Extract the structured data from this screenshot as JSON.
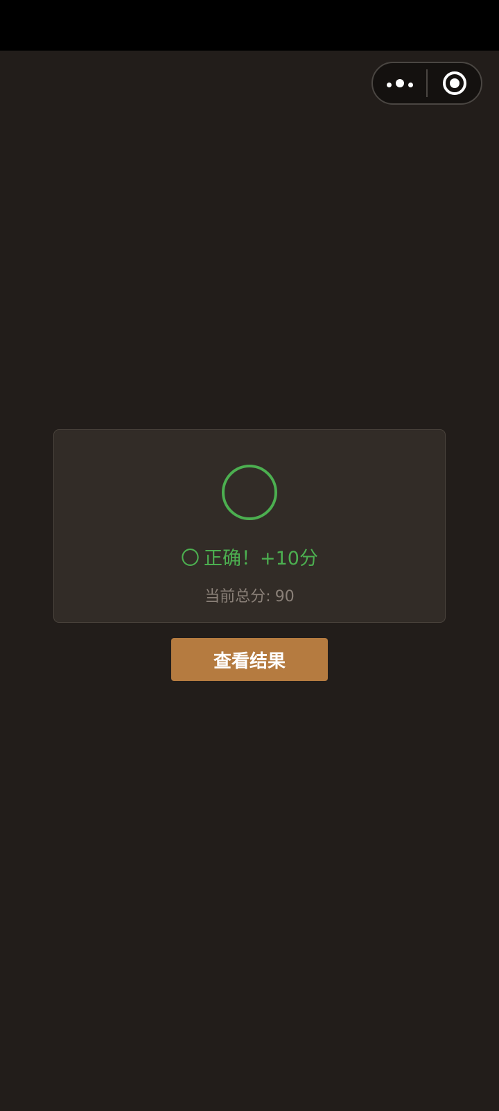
{
  "capsule": {
    "more_icon": "more-dots-icon",
    "close_icon": "target-icon"
  },
  "card": {
    "result_mark": "〇",
    "result_text": "正确！+10分",
    "score_label": "当前总分:",
    "score_value": "90"
  },
  "actions": {
    "view_result_label": "查看结果"
  },
  "colors": {
    "background": "#221d1a",
    "card_bg": "#322c27",
    "success": "#4caf50",
    "button": "#b57b40",
    "muted_text": "#8a8078"
  }
}
